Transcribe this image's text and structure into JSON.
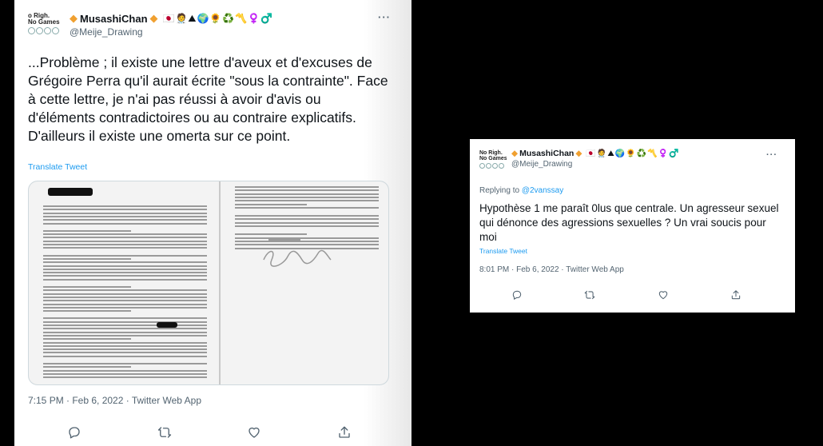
{
  "tweet1": {
    "avatar_text": [
      "o Righ.",
      "No Games"
    ],
    "display_name": "MusashiChan",
    "badge_glyph": "◆",
    "emoji": "🇯🇵🧑‍⚕️⛰🌍🌻♻️〽️♀️♂️",
    "handle": "@Meije_Drawing",
    "more": "···",
    "text": "...Problème ; il existe une lettre d'aveux et d'excuses de Grégoire Perra qu'il aurait écrite \"sous la contrainte\". Face à cette lettre, je n'ai pas réussi à avoir d'avis ou d'éléments contradictoires ou au contraire explicatifs. D'ailleurs il existe une omerta sur ce point.",
    "translate": "Translate Tweet",
    "image_alt": "scanned letter",
    "meta": "7:15 PM · Feb 6, 2022 · Twitter Web App",
    "actions": [
      "reply-icon",
      "retweet-icon",
      "like-icon",
      "share-icon"
    ]
  },
  "tweet2": {
    "avatar_text": [
      "No Righ.",
      "No Games"
    ],
    "display_name": "MusashiChan",
    "badge_glyph": "◆",
    "emoji": "🇯🇵🧑‍⚕️⛰🌍🌻♻️〽️♀️♂️",
    "handle": "@Meije_Drawing",
    "more": "···",
    "replying_prefix": "Replying to ",
    "replying_to": "@2vanssay",
    "text": "Hypothèse 1 me paraît 0lus que centrale. Un agresseur sexuel qui dénonce des agressions sexuelles ? Un vrai soucis pour moi",
    "translate": "Translate Tweet",
    "meta": "8:01 PM · Feb 6, 2022 · Twitter Web App",
    "actions": [
      "reply-icon",
      "retweet-icon",
      "like-icon",
      "share-icon"
    ]
  },
  "colors": {
    "link": "#1d9bf0",
    "muted": "#536471",
    "text": "#0f1419",
    "badge": "#f0a030"
  }
}
